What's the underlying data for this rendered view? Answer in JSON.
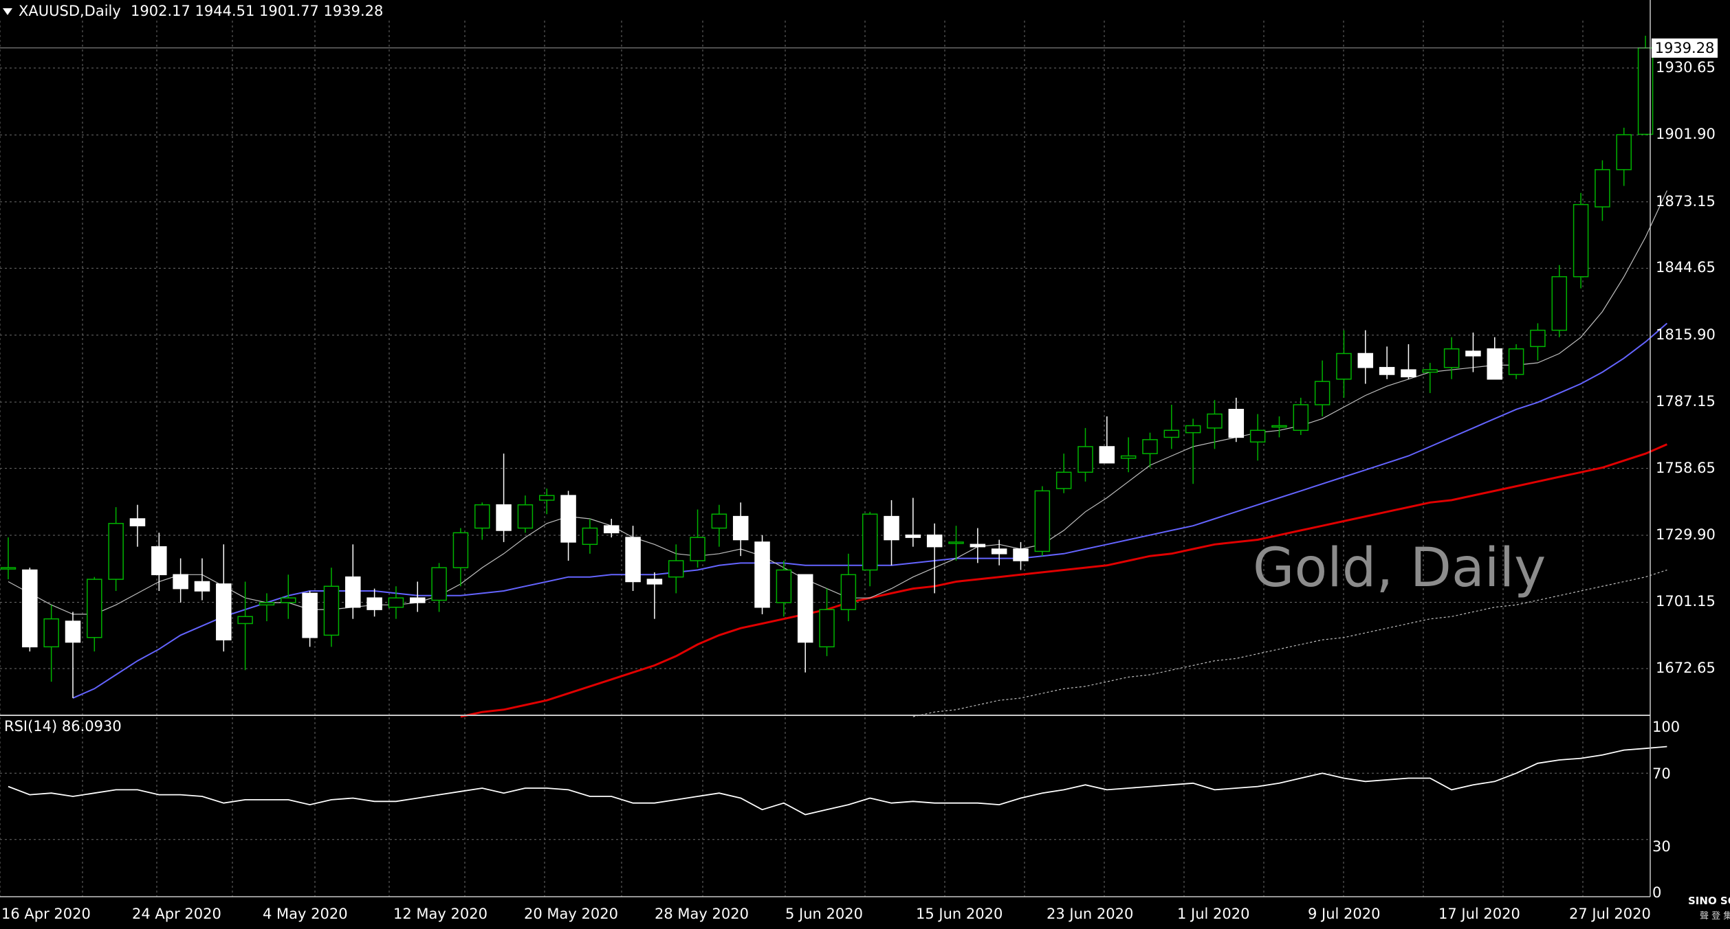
{
  "header": {
    "symbol": "XAUUSD,Daily",
    "ohlc": "1902.17 1944.51 1901.77 1939.28"
  },
  "watermark": "Gold, Daily",
  "current_price": "1939.28",
  "rsi_label": "RSI(14) 86.0930",
  "logo": {
    "name": "SINO SOUND",
    "sub": "聲 登 集 團"
  },
  "colors": {
    "background": "#000000",
    "grid": "#6e6e6e",
    "bull_candle": "#00b400",
    "bear_candle": "#ffffff",
    "ma_fast": "#c0c0c0",
    "ma_mid": "#6464ff",
    "ma_slow": "#e00000",
    "ma_long": "#c0c0c0",
    "rsi": "#ffffff"
  },
  "chart_data": [
    {
      "type": "candlestick",
      "title": "XAUUSD,Daily",
      "ylim": [
        1652,
        1949
      ],
      "y_ticks": [
        "1930.65",
        "1901.90",
        "1873.15",
        "1844.65",
        "1815.90",
        "1787.15",
        "1758.65",
        "1729.90",
        "1701.15",
        "1672.65"
      ],
      "x_ticks": [
        "16 Apr 2020",
        "24 Apr 2020",
        "4 May 2020",
        "12 May 2020",
        "20 May 2020",
        "28 May 2020",
        "5 Jun 2020",
        "15 Jun 2020",
        "23 Jun 2020",
        "1 Jul 2020",
        "9 Jul 2020",
        "17 Jul 2020",
        "27 Jul 2020"
      ],
      "grid": true,
      "candles": [
        {
          "date": "2020-04-15",
          "open": 1716,
          "high": 1729,
          "low": 1711,
          "close": 1716
        },
        {
          "date": "2020-04-16",
          "open": 1715,
          "high": 1716,
          "low": 1680,
          "close": 1682
        },
        {
          "date": "2020-04-17",
          "open": 1682,
          "high": 1700,
          "low": 1667,
          "close": 1694
        },
        {
          "date": "2020-04-20",
          "open": 1693,
          "high": 1697,
          "low": 1660,
          "close": 1684
        },
        {
          "date": "2020-04-21",
          "open": 1686,
          "high": 1712,
          "low": 1680,
          "close": 1711
        },
        {
          "date": "2020-04-22",
          "open": 1711,
          "high": 1742,
          "low": 1706,
          "close": 1735
        },
        {
          "date": "2020-04-23",
          "open": 1737,
          "high": 1743,
          "low": 1725,
          "close": 1734
        },
        {
          "date": "2020-04-24",
          "open": 1725,
          "high": 1731,
          "low": 1706,
          "close": 1713
        },
        {
          "date": "2020-04-27",
          "open": 1713,
          "high": 1720,
          "low": 1701,
          "close": 1707
        },
        {
          "date": "2020-04-28",
          "open": 1710,
          "high": 1720,
          "low": 1702,
          "close": 1706
        },
        {
          "date": "2020-04-29",
          "open": 1709,
          "high": 1726,
          "low": 1680,
          "close": 1685
        },
        {
          "date": "2020-04-30",
          "open": 1692,
          "high": 1710,
          "low": 1672,
          "close": 1695
        },
        {
          "date": "2020-05-01",
          "open": 1700,
          "high": 1705,
          "low": 1693,
          "close": 1701
        },
        {
          "date": "2020-05-04",
          "open": 1701,
          "high": 1713,
          "low": 1694,
          "close": 1703
        },
        {
          "date": "2020-05-05",
          "open": 1705,
          "high": 1706,
          "low": 1682,
          "close": 1686
        },
        {
          "date": "2020-05-06",
          "open": 1687,
          "high": 1716,
          "low": 1682,
          "close": 1708
        },
        {
          "date": "2020-05-07",
          "open": 1712,
          "high": 1726,
          "low": 1694,
          "close": 1699
        },
        {
          "date": "2020-05-08",
          "open": 1703,
          "high": 1707,
          "low": 1695,
          "close": 1698
        },
        {
          "date": "2020-05-11",
          "open": 1699,
          "high": 1708,
          "low": 1694,
          "close": 1703
        },
        {
          "date": "2020-05-12",
          "open": 1703,
          "high": 1710,
          "low": 1697,
          "close": 1701
        },
        {
          "date": "2020-05-13",
          "open": 1702,
          "high": 1718,
          "low": 1697,
          "close": 1716
        },
        {
          "date": "2020-05-14",
          "open": 1716,
          "high": 1733,
          "low": 1708,
          "close": 1731
        },
        {
          "date": "2020-05-15",
          "open": 1733,
          "high": 1744,
          "low": 1728,
          "close": 1743
        },
        {
          "date": "2020-05-18",
          "open": 1743,
          "high": 1765,
          "low": 1727,
          "close": 1732
        },
        {
          "date": "2020-05-19",
          "open": 1733,
          "high": 1747,
          "low": 1731,
          "close": 1743
        },
        {
          "date": "2020-05-20",
          "open": 1745,
          "high": 1750,
          "low": 1739,
          "close": 1747
        },
        {
          "date": "2020-05-21",
          "open": 1747,
          "high": 1749,
          "low": 1719,
          "close": 1727
        },
        {
          "date": "2020-05-22",
          "open": 1726,
          "high": 1737,
          "low": 1722,
          "close": 1733
        },
        {
          "date": "2020-05-25",
          "open": 1734,
          "high": 1737,
          "low": 1729,
          "close": 1731
        },
        {
          "date": "2020-05-26",
          "open": 1729,
          "high": 1734,
          "low": 1706,
          "close": 1710
        },
        {
          "date": "2020-05-27",
          "open": 1711,
          "high": 1714,
          "low": 1694,
          "close": 1709
        },
        {
          "date": "2020-05-28",
          "open": 1712,
          "high": 1726,
          "low": 1705,
          "close": 1719
        },
        {
          "date": "2020-05-29",
          "open": 1719,
          "high": 1741,
          "low": 1716,
          "close": 1729
        },
        {
          "date": "2020-06-01",
          "open": 1733,
          "high": 1743,
          "low": 1725,
          "close": 1739
        },
        {
          "date": "2020-06-02",
          "open": 1738,
          "high": 1744,
          "low": 1721,
          "close": 1728
        },
        {
          "date": "2020-06-03",
          "open": 1727,
          "high": 1730,
          "low": 1696,
          "close": 1699
        },
        {
          "date": "2020-06-04",
          "open": 1701,
          "high": 1719,
          "low": 1695,
          "close": 1715
        },
        {
          "date": "2020-06-05",
          "open": 1713,
          "high": 1713,
          "low": 1671,
          "close": 1684
        },
        {
          "date": "2020-06-08",
          "open": 1682,
          "high": 1707,
          "low": 1678,
          "close": 1698
        },
        {
          "date": "2020-06-09",
          "open": 1698,
          "high": 1722,
          "low": 1693,
          "close": 1713
        },
        {
          "date": "2020-06-10",
          "open": 1715,
          "high": 1740,
          "low": 1708,
          "close": 1739
        },
        {
          "date": "2020-06-11",
          "open": 1738,
          "high": 1745,
          "low": 1717,
          "close": 1728
        },
        {
          "date": "2020-06-12",
          "open": 1730,
          "high": 1746,
          "low": 1725,
          "close": 1729
        },
        {
          "date": "2020-06-15",
          "open": 1730,
          "high": 1735,
          "low": 1705,
          "close": 1725
        },
        {
          "date": "2020-06-16",
          "open": 1727,
          "high": 1734,
          "low": 1719,
          "close": 1727
        },
        {
          "date": "2020-06-17",
          "open": 1726,
          "high": 1733,
          "low": 1718,
          "close": 1725
        },
        {
          "date": "2020-06-18",
          "open": 1724,
          "high": 1728,
          "low": 1717,
          "close": 1722
        },
        {
          "date": "2020-06-19",
          "open": 1724,
          "high": 1727,
          "low": 1715,
          "close": 1719
        },
        {
          "date": "2020-06-22",
          "open": 1723,
          "high": 1751,
          "low": 1721,
          "close": 1749
        },
        {
          "date": "2020-06-23",
          "open": 1750,
          "high": 1765,
          "low": 1748,
          "close": 1757
        },
        {
          "date": "2020-06-24",
          "open": 1757,
          "high": 1776,
          "low": 1753,
          "close": 1768
        },
        {
          "date": "2020-06-25",
          "open": 1768,
          "high": 1781,
          "low": 1761,
          "close": 1761
        },
        {
          "date": "2020-06-26",
          "open": 1763,
          "high": 1772,
          "low": 1757,
          "close": 1764
        },
        {
          "date": "2020-06-29",
          "open": 1765,
          "high": 1774,
          "low": 1759,
          "close": 1771
        },
        {
          "date": "2020-06-30",
          "open": 1772,
          "high": 1786,
          "low": 1767,
          "close": 1775
        },
        {
          "date": "2020-07-01",
          "open": 1774,
          "high": 1780,
          "low": 1752,
          "close": 1777
        },
        {
          "date": "2020-07-02",
          "open": 1776,
          "high": 1788,
          "low": 1767,
          "close": 1782
        },
        {
          "date": "2020-07-03",
          "open": 1784,
          "high": 1789,
          "low": 1770,
          "close": 1772
        },
        {
          "date": "2020-07-06",
          "open": 1770,
          "high": 1782,
          "low": 1762,
          "close": 1775
        },
        {
          "date": "2020-07-07",
          "open": 1777,
          "high": 1781,
          "low": 1772,
          "close": 1777
        },
        {
          "date": "2020-07-08",
          "open": 1775,
          "high": 1789,
          "low": 1773,
          "close": 1786
        },
        {
          "date": "2020-07-09",
          "open": 1786,
          "high": 1805,
          "low": 1781,
          "close": 1796
        },
        {
          "date": "2020-07-10",
          "open": 1797,
          "high": 1818,
          "low": 1789,
          "close": 1808
        },
        {
          "date": "2020-07-13",
          "open": 1808,
          "high": 1818,
          "low": 1795,
          "close": 1802
        },
        {
          "date": "2020-07-14",
          "open": 1802,
          "high": 1811,
          "low": 1797,
          "close": 1799
        },
        {
          "date": "2020-07-15",
          "open": 1801,
          "high": 1812,
          "low": 1797,
          "close": 1798
        },
        {
          "date": "2020-07-16",
          "open": 1800,
          "high": 1804,
          "low": 1791,
          "close": 1801
        },
        {
          "date": "2020-07-17",
          "open": 1802,
          "high": 1815,
          "low": 1797,
          "close": 1810
        },
        {
          "date": "2020-07-20",
          "open": 1809,
          "high": 1817,
          "low": 1800,
          "close": 1807
        },
        {
          "date": "2020-07-21",
          "open": 1810,
          "high": 1815,
          "low": 1797,
          "close": 1797
        },
        {
          "date": "2020-07-22",
          "open": 1799,
          "high": 1812,
          "low": 1797,
          "close": 1810
        },
        {
          "date": "2020-07-23",
          "open": 1811,
          "high": 1821,
          "low": 1805,
          "close": 1818
        },
        {
          "date": "2020-07-24",
          "open": 1818,
          "high": 1846,
          "low": 1815,
          "close": 1841
        },
        {
          "date": "2020-07-27",
          "open": 1841,
          "high": 1877,
          "low": 1836,
          "close": 1872
        },
        {
          "date": "2020-07-28",
          "open": 1871,
          "high": 1891,
          "low": 1865,
          "close": 1887
        },
        {
          "date": "2020-07-29",
          "open": 1887,
          "high": 1905,
          "low": 1880,
          "close": 1902
        },
        {
          "date": "2020-07-30",
          "open": 1902.17,
          "high": 1944.51,
          "low": 1901.77,
          "close": 1939.28
        }
      ],
      "ma_fast": [
        1710,
        1705,
        1700,
        1696,
        1696,
        1700,
        1705,
        1710,
        1713,
        1713,
        1708,
        1703,
        1701,
        1701,
        1698,
        1698,
        1699,
        1700,
        1700,
        1701,
        1704,
        1709,
        1716,
        1722,
        1729,
        1735,
        1738,
        1737,
        1734,
        1729,
        1726,
        1722,
        1721,
        1722,
        1724,
        1721,
        1716,
        1711,
        1707,
        1703,
        1703,
        1707,
        1712,
        1716,
        1720,
        1725,
        1726,
        1724,
        1726,
        1732,
        1740,
        1746,
        1753,
        1760,
        1764,
        1768,
        1770,
        1772,
        1774,
        1775,
        1777,
        1780,
        1785,
        1790,
        1794,
        1797,
        1800,
        1801,
        1802,
        1803,
        1803,
        1804,
        1808,
        1815,
        1826,
        1841,
        1858,
        1878
      ],
      "ma_mid": [
        null,
        null,
        null,
        1660,
        1664,
        1670,
        1676,
        1681,
        1687,
        1691,
        1695,
        1698,
        1701,
        1704,
        1706,
        1706,
        1706,
        1706,
        1705,
        1704,
        1704,
        1704,
        1705,
        1706,
        1708,
        1710,
        1712,
        1712,
        1713,
        1713,
        1713,
        1714,
        1715,
        1717,
        1718,
        1718,
        1718,
        1717,
        1717,
        1717,
        1717,
        1717,
        1718,
        1719,
        1720,
        1720,
        1720,
        1720,
        1721,
        1722,
        1724,
        1726,
        1728,
        1730,
        1732,
        1734,
        1737,
        1740,
        1743,
        1746,
        1749,
        1752,
        1755,
        1758,
        1761,
        1764,
        1768,
        1772,
        1776,
        1780,
        1784,
        1787,
        1791,
        1795,
        1800,
        1806,
        1813,
        1821
      ],
      "ma_slow": [
        null,
        null,
        null,
        null,
        null,
        null,
        null,
        null,
        null,
        null,
        null,
        null,
        null,
        null,
        null,
        null,
        null,
        null,
        null,
        null,
        null,
        1652,
        1654,
        1655,
        1657,
        1659,
        1662,
        1665,
        1668,
        1671,
        1674,
        1678,
        1683,
        1687,
        1690,
        1692,
        1694,
        1696,
        1698,
        1701,
        1703,
        1705,
        1707,
        1708,
        1710,
        1711,
        1712,
        1713,
        1714,
        1715,
        1716,
        1717,
        1719,
        1721,
        1722,
        1724,
        1726,
        1727,
        1728,
        1730,
        1732,
        1734,
        1736,
        1738,
        1740,
        1742,
        1744,
        1745,
        1747,
        1749,
        1751,
        1753,
        1755,
        1757,
        1759,
        1762,
        1765,
        1769
      ],
      "ma_long": [
        null,
        null,
        null,
        null,
        null,
        null,
        null,
        null,
        null,
        null,
        null,
        null,
        null,
        null,
        null,
        null,
        null,
        null,
        null,
        null,
        null,
        null,
        null,
        null,
        null,
        null,
        null,
        null,
        null,
        null,
        null,
        null,
        null,
        null,
        null,
        null,
        null,
        null,
        null,
        null,
        null,
        null,
        1652,
        1654,
        1655,
        1657,
        1659,
        1660,
        1662,
        1664,
        1665,
        1667,
        1669,
        1670,
        1672,
        1674,
        1676,
        1677,
        1679,
        1681,
        1683,
        1685,
        1686,
        1688,
        1690,
        1692,
        1694,
        1695,
        1697,
        1699,
        1700,
        1702,
        1704,
        1706,
        1708,
        1710,
        1712,
        1715
      ]
    },
    {
      "type": "line",
      "title": "RSI(14) 86.0930",
      "ylim": [
        0,
        100
      ],
      "y_ticks": [
        "100",
        "70",
        "30",
        "0"
      ],
      "levels": [
        70,
        30
      ],
      "values": [
        62,
        57,
        58,
        56,
        58,
        60,
        60,
        57,
        57,
        56,
        52,
        54,
        54,
        54,
        51,
        54,
        55,
        53,
        53,
        55,
        57,
        59,
        61,
        58,
        61,
        61,
        60,
        56,
        56,
        52,
        52,
        54,
        56,
        58,
        55,
        48,
        52,
        45,
        48,
        51,
        55,
        52,
        53,
        52,
        52,
        52,
        51,
        55,
        58,
        60,
        63,
        60,
        61,
        62,
        63,
        64,
        60,
        61,
        62,
        64,
        67,
        70,
        67,
        65,
        66,
        67,
        67,
        60,
        63,
        65,
        70,
        76,
        78,
        79,
        81,
        84,
        85,
        86.093
      ]
    }
  ]
}
